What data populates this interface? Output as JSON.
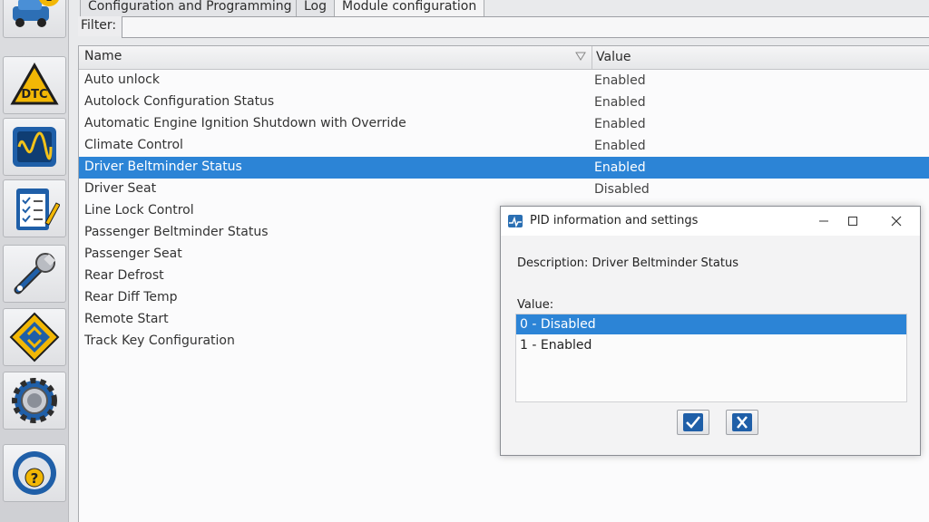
{
  "tabs": [
    {
      "label": "Configuration and Programming"
    },
    {
      "label": "Log"
    },
    {
      "label": "Module configuration"
    }
  ],
  "filter": {
    "label": "Filter:",
    "value": ""
  },
  "table": {
    "columns": [
      "Name",
      "Value"
    ],
    "rows": [
      {
        "name": "Auto unlock",
        "value": "Enabled"
      },
      {
        "name": "Autolock Configuration Status",
        "value": "Enabled"
      },
      {
        "name": "Automatic Engine Ignition Shutdown with Override",
        "value": "Enabled"
      },
      {
        "name": "Climate Control",
        "value": "Enabled"
      },
      {
        "name": "Driver Beltminder Status",
        "value": "Enabled"
      },
      {
        "name": "Driver Seat",
        "value": "Disabled"
      },
      {
        "name": "Line Lock Control",
        "value": ""
      },
      {
        "name": "Passenger Beltminder Status",
        "value": ""
      },
      {
        "name": "Passenger Seat",
        "value": ""
      },
      {
        "name": "Rear Defrost",
        "value": ""
      },
      {
        "name": "Rear Diff Temp",
        "value": ""
      },
      {
        "name": "Remote Start",
        "value": ""
      },
      {
        "name": "Track Key Configuration",
        "value": ""
      }
    ],
    "selected_index": 4
  },
  "dialog": {
    "title": "PID information and settings",
    "description": "Description: Driver Beltminder Status",
    "value_label": "Value:",
    "options": [
      {
        "label": "0 - Disabled"
      },
      {
        "label": "1 - Enabled"
      }
    ],
    "selected_option": 0
  },
  "toolbar_icons": [
    "info-car-icon",
    "dtc-icon",
    "oscilloscope-icon",
    "checklist-icon",
    "wrench-icon",
    "module-chip-icon",
    "settings-gear-icon",
    "help-wheel-icon"
  ],
  "colors": {
    "selection": "#2c84d6",
    "accent_blue": "#1f5fa8",
    "dtc_yellow": "#f2b705"
  }
}
